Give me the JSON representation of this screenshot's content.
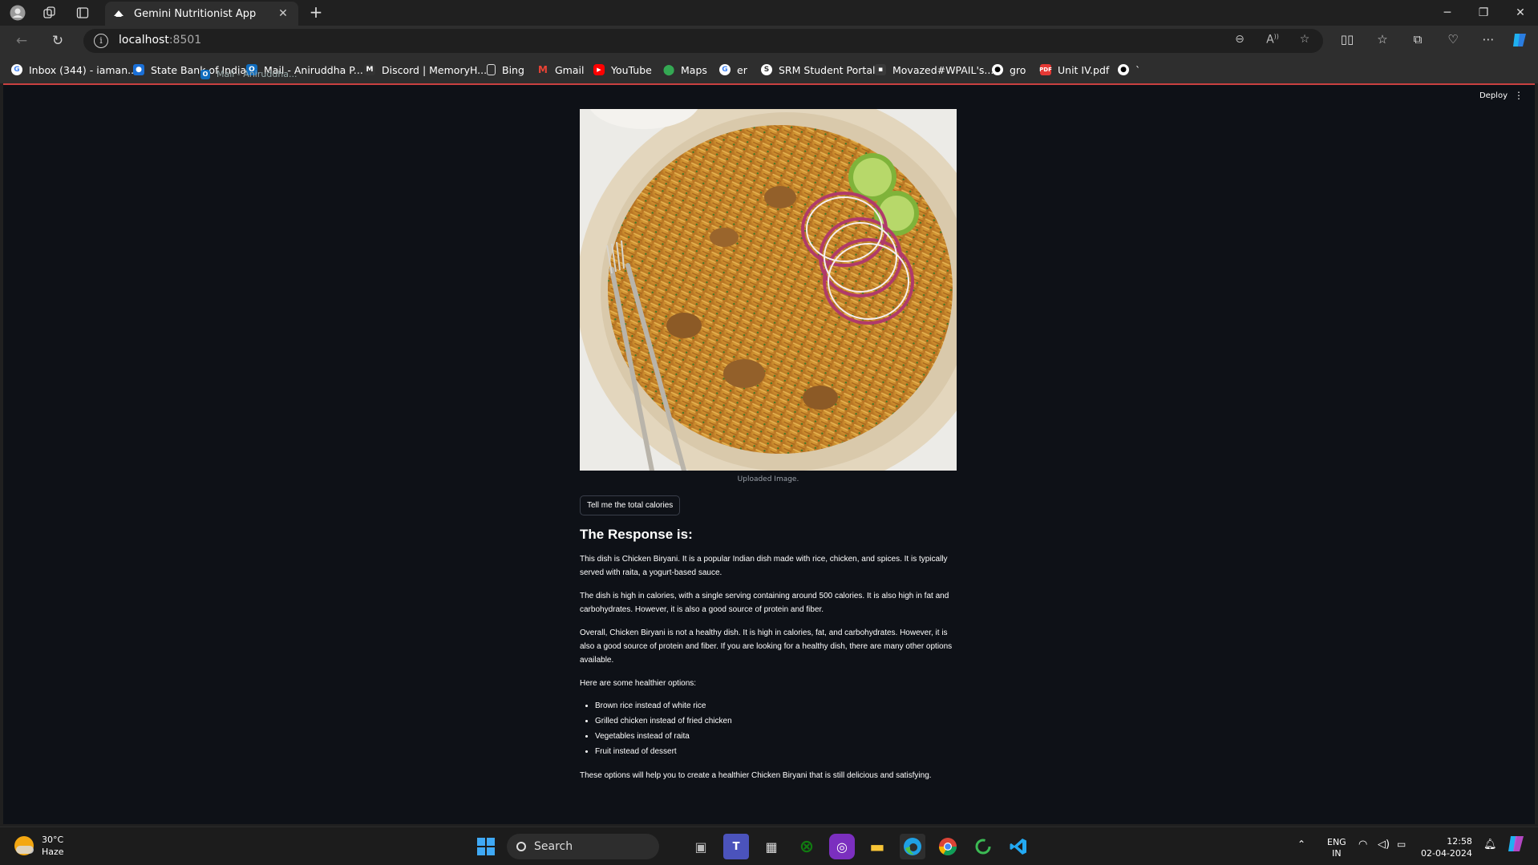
{
  "browser": {
    "tab_title": "Gemini Nutritionist App",
    "url_host": "localhost",
    "url_port": ":8501"
  },
  "bookmarks": [
    {
      "label": "Inbox (344) - iaman...",
      "icon": "google-icon",
      "color": "#ffffff"
    },
    {
      "label": "State Bank of India",
      "icon": "sbi-icon",
      "color": "#1a6fd6"
    },
    {
      "label": "Mail - Aniruddha P...",
      "icon": "outlook-icon",
      "color": "#0f6cbd"
    },
    {
      "label": "Discord | MemoryH...",
      "icon": "discord-icon",
      "color": "#333333"
    },
    {
      "label": "Bing",
      "icon": "file-icon",
      "color": "#2e2e2e"
    },
    {
      "label": "Gmail",
      "icon": "gmail-icon",
      "color": "#2e2e2e"
    },
    {
      "label": "YouTube",
      "icon": "youtube-icon",
      "color": "#ff0000"
    },
    {
      "label": "Maps",
      "icon": "maps-icon",
      "color": "#34a853"
    },
    {
      "label": "er",
      "icon": "google-icon",
      "color": "#ffffff"
    },
    {
      "label": "SRM Student Portal",
      "icon": "srm-icon",
      "color": "#ffffff"
    },
    {
      "label": "Movazed#WPAIL's...",
      "icon": "movie-icon",
      "color": "#3a3a3a"
    },
    {
      "label": "gro",
      "icon": "github-icon",
      "color": "#ffffff"
    },
    {
      "label": "Unit IV.pdf",
      "icon": "pdf-icon",
      "color": "#e53935"
    },
    {
      "label": "`",
      "icon": "github-icon",
      "color": "#ffffff"
    }
  ],
  "drag_ghost": "Mail - Aniruddha...",
  "app": {
    "deploy_label": "Deploy",
    "image_caption": "Uploaded Image.",
    "submit_button": "Tell me the total calories",
    "response_heading": "The Response is:",
    "paragraphs": [
      "This dish is Chicken Biryani. It is a popular Indian dish made with rice, chicken, and spices. It is typically served with raita, a yogurt-based sauce.",
      "The dish is high in calories, with a single serving containing around 500 calories. It is also high in fat and carbohydrates. However, it is also a good source of protein and fiber.",
      "Overall, Chicken Biryani is not a healthy dish. It is high in calories, fat, and carbohydrates. However, it is also a good source of protein and fiber. If you are looking for a healthy dish, there are many other options available.",
      "Here are some healthier options:"
    ],
    "options": [
      "Brown rice instead of white rice",
      "Grilled chicken instead of fried chicken",
      "Vegetables instead of raita",
      "Fruit instead of dessert"
    ],
    "closing": "These options will help you to create a healthier Chicken Biryani that is still delicious and satisfying."
  },
  "taskbar": {
    "weather_temp": "30°C",
    "weather_desc": "Haze",
    "search_label": "Search",
    "lang_top": "ENG",
    "lang_bottom": "IN",
    "time": "12:58",
    "date": "02-04-2024"
  },
  "colors": {
    "app_background": "#0e1117",
    "browser_chrome": "#2e2e2e",
    "accent_line": "#c94040"
  }
}
